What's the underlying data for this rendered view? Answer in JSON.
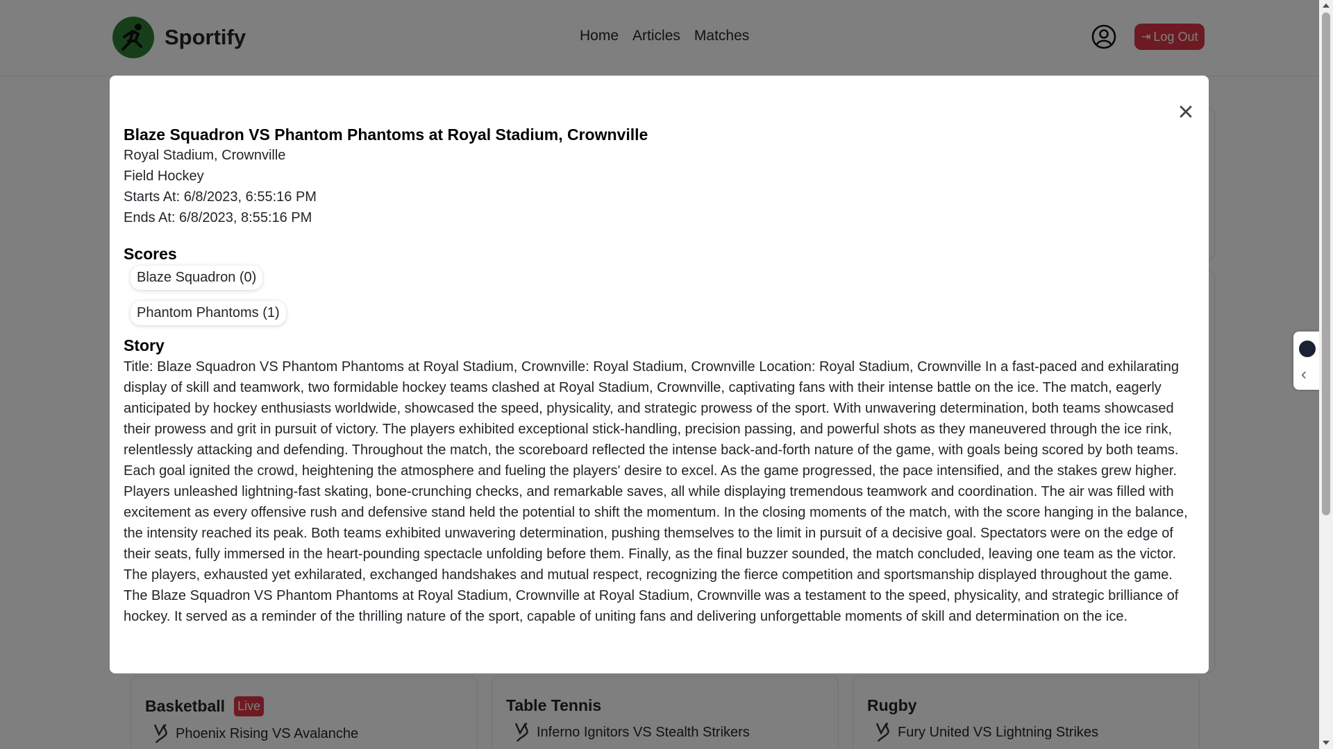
{
  "brand": {
    "name": "Sportify",
    "logo_icon": "running-athlete-icon"
  },
  "nav": {
    "links": [
      "Home",
      "Articles",
      "Matches"
    ]
  },
  "header": {
    "logout_label": "Log Out",
    "profile_icon": "user-circle-icon"
  },
  "colors": {
    "accent_red": "#dc3545",
    "brand_green": "#2e7d32"
  },
  "modal": {
    "title": "Blaze Squadron VS Phantom Phantoms at Royal Stadium, Crownville",
    "venue": "Royal Stadium, Crownville",
    "sport": "Field Hockey",
    "starts_at": "Starts At: 6/8/2023, 6:55:16 PM",
    "ends_at": "Ends At: 6/8/2023, 8:55:16 PM",
    "scores_heading": "Scores",
    "scores": [
      "Blaze Squadron (0)",
      "Phantom Phantoms (1)"
    ],
    "story_heading": "Story",
    "story": "Title: Blaze Squadron VS Phantom Phantoms at Royal Stadium, Crownville: Royal Stadium, Crownville Location: Royal Stadium, Crownville In a fast-paced and exhilarating display of skill and teamwork, two formidable hockey teams clashed at Royal Stadium, Crownville, captivating fans with their intense battle on the ice. The match, eagerly anticipated by hockey enthusiasts worldwide, showcased the speed, physicality, and strategic prowess of the sport. With unwavering determination, both teams showcased their prowess and grit in pursuit of victory. The players exhibited exceptional stick-handling, precision passing, and powerful shots as they maneuvered through the ice rink, relentlessly attacking and defending. Throughout the match, the scoreboard reflected the intense back-and-forth nature of the game, with goals being scored by both teams. Each goal ignited the crowd, heightening the atmosphere and fueling the players' desire to excel. As the game progressed, the pace intensified, and the stakes grew higher. Players unleashed lightning-fast skating, bone-crunching checks, and remarkable saves, all while displaying tremendous teamwork and coordination. The air was filled with excitement as every offensive rush and defensive stand held the potential to shift the momentum. In the closing moments of the match, with the score hanging in the balance, the intensity reached its peak. Both teams exhibited unwavering determination, pushing themselves to the limit in pursuit of a decisive goal. Spectators were on the edge of their seats, fully immersed in the heart-pounding spectacle unfolding before them. Finally, as the final buzzer sounded, the match concluded, leaving one team as the victor. The players, exhausted yet exhilarated, exchanged handshakes and mutual respect, recognizing the fierce competition and sportsmanship displayed throughout the game. The Blaze Squadron VS Phantom Phantoms at Royal Stadium, Crownville at Royal Stadium, Crownville was a testament to the speed, physicality, and strategic brilliance of hockey. It served as a reminder of the thrilling nature of the sport, capable of uniting fans and delivering unforgettable moments of skill and determination on the ice."
  },
  "sport_cards": [
    {
      "sport": "Basketball",
      "badge": "Live",
      "match": "Phoenix Rising VS Avalanche"
    },
    {
      "sport": "Table Tennis",
      "badge": "",
      "match": "Inferno Ignitors VS Stealth Strikers"
    },
    {
      "sport": "Rugby",
      "badge": "",
      "match": "Fury United VS Lightning Strikes"
    }
  ]
}
